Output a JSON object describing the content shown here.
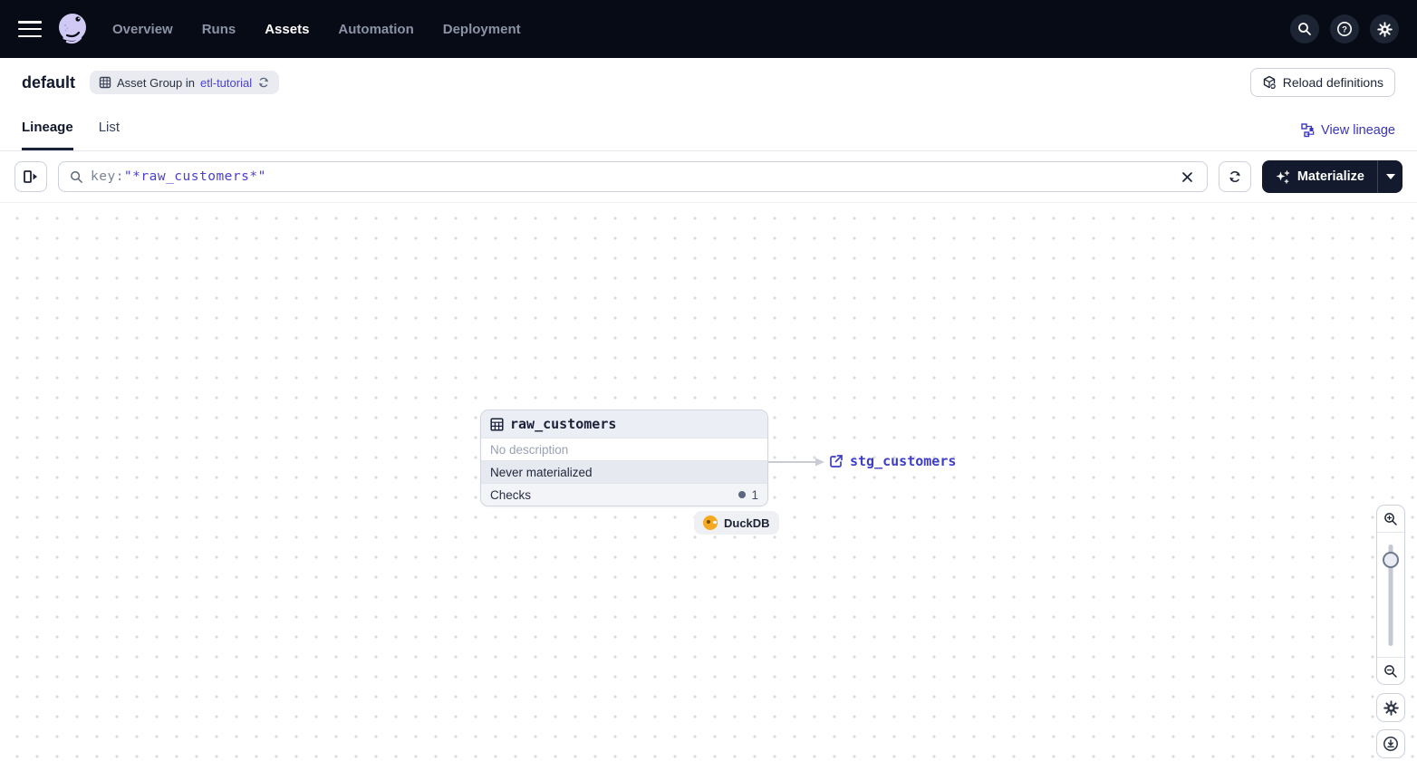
{
  "topnav": {
    "nav_items": [
      {
        "label": "Overview",
        "active": false
      },
      {
        "label": "Runs",
        "active": false
      },
      {
        "label": "Assets",
        "active": true
      },
      {
        "label": "Automation",
        "active": false
      },
      {
        "label": "Deployment",
        "active": false
      }
    ]
  },
  "header": {
    "title": "default",
    "badge_label": "Asset Group in",
    "badge_link": "etl-tutorial",
    "reload_label": "Reload definitions"
  },
  "tabs": {
    "lineage_label": "Lineage",
    "list_label": "List",
    "view_lineage_label": "View lineage"
  },
  "toolbar": {
    "filter_key": "key:",
    "filter_value": "\"*raw_customers*\"",
    "materialize_label": "Materialize"
  },
  "graph": {
    "asset": {
      "name": "raw_customers",
      "description": "No description",
      "status": "Never materialized",
      "checks_label": "Checks",
      "checks_count": "1",
      "kind_tag": "DuckDB"
    },
    "downstream_asset": "stg_customers"
  },
  "icons": {
    "menu-icon": "hamburger three lines",
    "dagster-logo": "lavender octopus swirl",
    "search-icon": "magnifier",
    "help-icon": "circled question mark",
    "gear-icon": "settings gear",
    "asset-group-icon": "table grid",
    "sync-icon": "circular arrows",
    "reload-icon": "cube with refresh arrow",
    "lineage-graph-icon": "connected nodes",
    "panel-toggle-icon": "sidebar with right arrow",
    "close-icon": "x",
    "sparkle-icon": "four point star with sparks",
    "caret-down-icon": "down triangle",
    "table-icon": "table grid",
    "external-link-icon": "box with outgoing arrow",
    "zoom-in-icon": "magnifier plus",
    "zoom-out-icon": "magnifier minus",
    "recenter-icon": "circled down arrow"
  },
  "colors": {
    "navbar_bg": "#070b15",
    "accent_indigo": "#4a42cf",
    "materialize_bg": "#131a2e",
    "duckdb_yellow": "#f5a922",
    "status_row_bg": "#e7e9f0"
  }
}
